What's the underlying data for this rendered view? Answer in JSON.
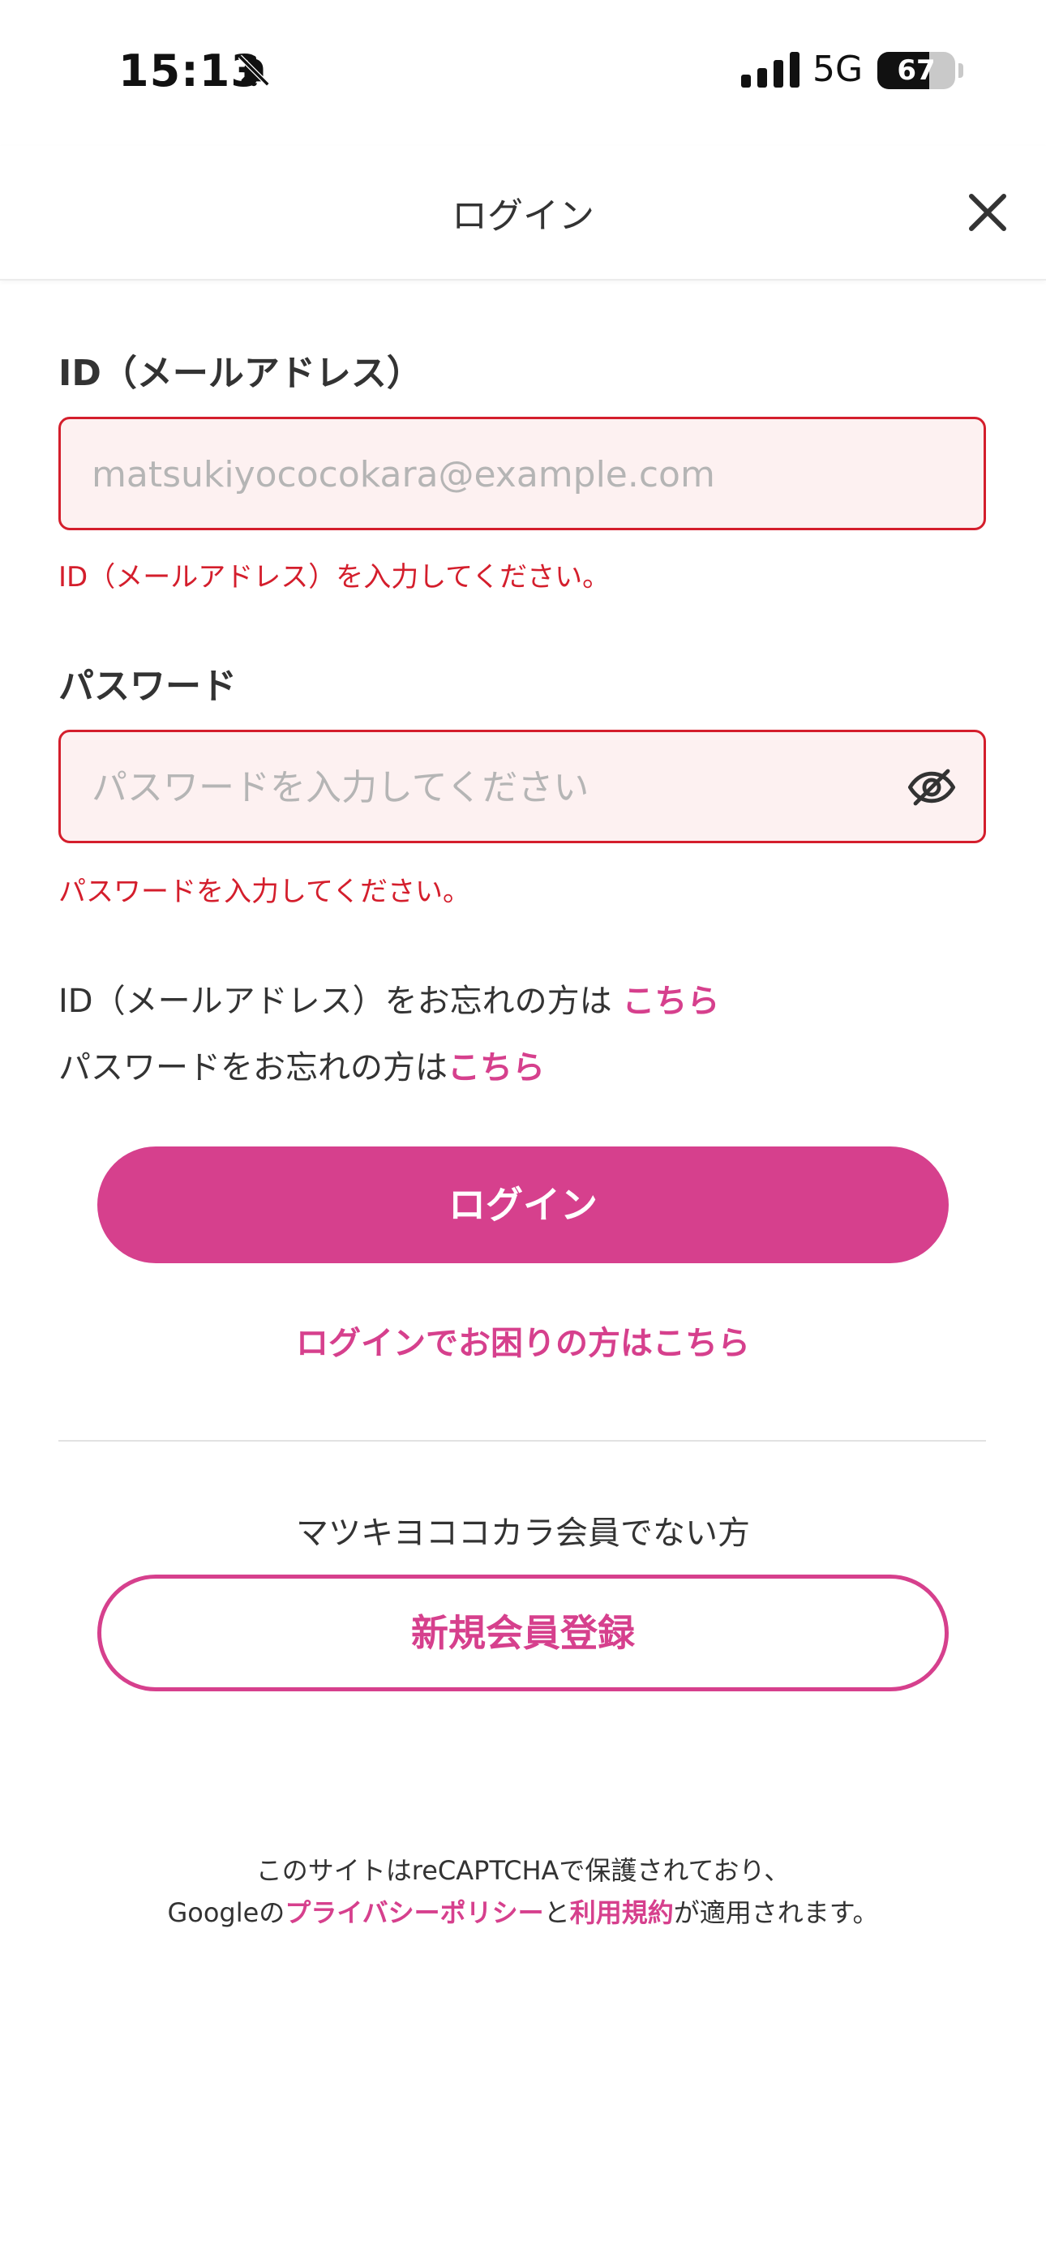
{
  "status_bar": {
    "time": "15:13",
    "network": "5G",
    "battery_level": "67",
    "battery_fraction": 0.67
  },
  "header": {
    "title": "ログイン",
    "close_icon": "close-icon"
  },
  "form": {
    "id_label": "ID（メールアドレス）",
    "id_placeholder": "matsukiyococokara@example.com",
    "id_value": "",
    "id_error": "ID（メールアドレス）を入力してください。",
    "password_label": "パスワード",
    "password_placeholder": "パスワードを入力してください",
    "password_value": "",
    "password_error": "パスワードを入力してください。",
    "password_toggle_icon": "eye-off-icon"
  },
  "forgot": {
    "id_text": "ID（メールアドレス）をお忘れの方は",
    "id_link": "こちら",
    "password_text": "パスワードをお忘れの方は",
    "password_link": "こちら"
  },
  "actions": {
    "login_button": "ログイン",
    "help_link": "ログインでお困りの方はこちら",
    "not_member_text": "マツキヨココカラ会員でない方",
    "register_button": "新規会員登録"
  },
  "recaptcha": {
    "line1": "このサイトはreCAPTCHAで保護されており、",
    "line2_prefix": "Googleの",
    "privacy_link": "プライバシーポリシー",
    "line2_middle": "と",
    "terms_link": "利用規約",
    "line2_suffix": "が適用されます。"
  },
  "colors": {
    "accent_pink": "#d6408d",
    "error_red": "#d41e2c",
    "error_bg": "#fdf1f1"
  }
}
